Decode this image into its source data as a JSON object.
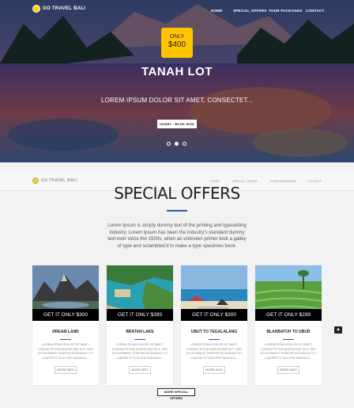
{
  "brand": {
    "name": "GO TRAVEL BALI"
  },
  "nav": {
    "items": [
      "HOME",
      "SPECIAL OFFERS",
      "TOUR PACKAGES",
      "CONTACT"
    ]
  },
  "hero": {
    "badge_line1": "ONLY",
    "badge_line2": "$400",
    "title": "TANAH LOT",
    "subtitle": "LOREM IPSUM DOLOR SIT AMET, CONSECTET...",
    "button": "HURRY - BOOK NOW",
    "slides": 3,
    "active_slide": 2
  },
  "sticky_nav": {
    "items": [
      "HOME",
      "SPECIAL OFFER",
      "TOUR PACKAGES",
      "CONTACT"
    ]
  },
  "offers": {
    "title": "SPECIAL OFFERS",
    "intro": "Lorem Ipsum is simply dummy text of the printing and typesetting industry. Lorem Ipsum has been the industry's standard dummy text ever since the 1500s, when an unknown printer took a galley of type and scrambled it to make a type specimen book.",
    "cards": [
      {
        "price": "GET IT ONLY $300",
        "name": "DREAM LAND",
        "desc": "LOREM IPSUM DOLOR SIT AMET, CONSECTETUR ADIPISCING ELIT, SED DO EIUSMOD TEMPOR INCIDIDUNT UT LABORE ET DOLORE MAGNA A...",
        "more": "MORE INFO"
      },
      {
        "price": "GET IT ONLY $399",
        "name": "BRATAN LAKE",
        "desc": "LOREM IPSUM DOLOR SIT AMET, CONSECTETUR ADIPISCING ELIT, SED DO EIUSMOD TEMPOR INCIDIDUNT UT LABORE ET DOLORE MAGNA A...",
        "more": "MORE INFO"
      },
      {
        "price": "GET IT ONLY $300",
        "name": "UBUT TO TEGALALANG",
        "desc": "LOREM IPSUM DOLOR SIT AMET, CONSECTETUR ADIPISCING ELIT, SED DO EIUSMOD TEMPOR INCIDIDUNT UT LABORE ET DOLORE MAGNA A...",
        "more": "MORE INFO"
      },
      {
        "price": "GET IT ONLY $299",
        "name": "BLAHBATUH TO UBUD",
        "desc": "LOREM IPSUM DOLOR SIT AMET, CONSECTETUR ADIPISCING ELIT, SED DO EIUSMOD TEMPOR INCIDIDUNT UT LABORE ET DOLORE MAGNA A...",
        "more": "MORE INFO"
      }
    ],
    "more_button": "MORE SPECIAL OFFERS"
  },
  "icons": {
    "scroll_top": "chevron-up-icon"
  },
  "colors": {
    "accent": "#2a5fa5",
    "badge": "#ffc400"
  }
}
